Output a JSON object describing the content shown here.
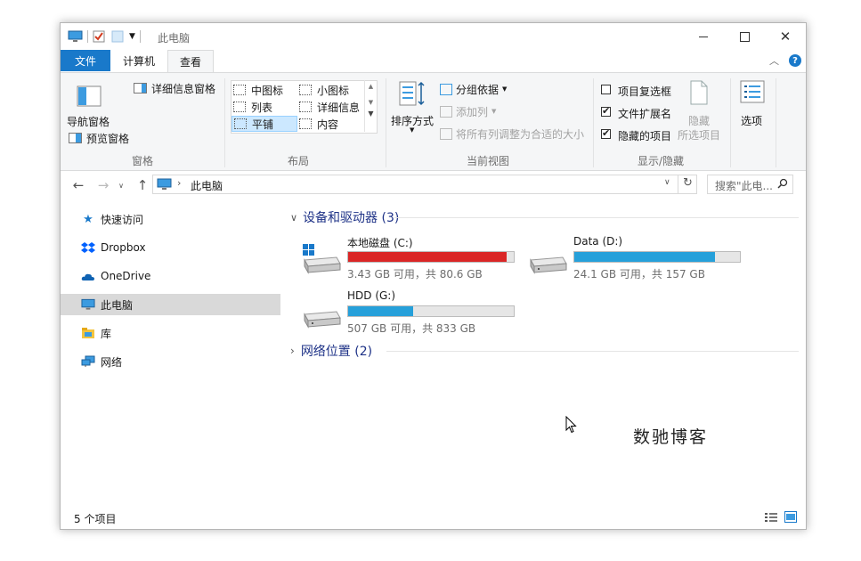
{
  "window": {
    "title": "此电脑"
  },
  "tabs": {
    "file": "文件",
    "computer": "计算机",
    "view": "查看"
  },
  "ribbon": {
    "panes": {
      "nav_pane": "导航窗格",
      "details_pane": "详细信息窗格",
      "preview_pane": "预览窗格",
      "label": "窗格"
    },
    "layout": {
      "items": [
        "中图标",
        "小图标",
        "列表",
        "详细信息",
        "平铺",
        "内容"
      ],
      "label": "布局"
    },
    "current_view": {
      "sort_by": "排序方式",
      "group_by": "分组依据",
      "add_columns": "添加列",
      "size_columns": "将所有列调整为合适的大小",
      "label": "当前视图"
    },
    "show_hide": {
      "item_checkboxes": "项目复选框",
      "file_extensions": "文件扩展名",
      "hidden_items": "隐藏的项目",
      "hide": "隐藏",
      "selected_items": "所选项目",
      "label": "显示/隐藏"
    },
    "options": "选项"
  },
  "address": {
    "path": "此电脑",
    "search_placeholder": "搜索\"此电..."
  },
  "sidebar": {
    "items": [
      "快速访问",
      "Dropbox",
      "OneDrive",
      "此电脑",
      "库",
      "网络"
    ]
  },
  "content": {
    "devices_header": "设备和驱动器 (3)",
    "network_header": "网络位置 (2)",
    "drives": [
      {
        "name": "本地磁盘 (C:)",
        "info": "3.43 GB 可用，共 80.6 GB",
        "used_fraction": 0.957,
        "color": "#da2626"
      },
      {
        "name": "Data (D:)",
        "info": "24.1 GB 可用，共 157 GB",
        "used_fraction": 0.847,
        "color": "#26a0da"
      },
      {
        "name": "HDD (G:)",
        "info": "507 GB 可用，共 833 GB",
        "used_fraction": 0.391,
        "color": "#26a0da"
      }
    ]
  },
  "status": {
    "count": "5 个项目"
  },
  "watermark": "数驰博客"
}
